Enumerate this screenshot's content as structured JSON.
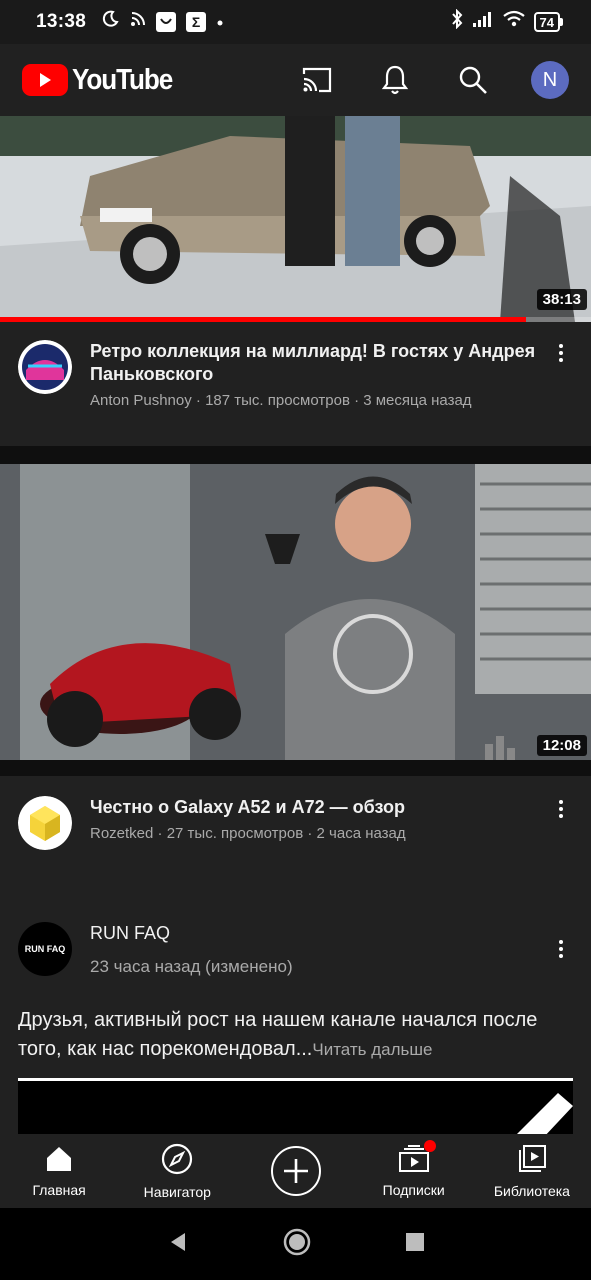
{
  "status_bar": {
    "time": "13:38",
    "battery": "74"
  },
  "app_bar": {
    "logo_text": "YouTube",
    "avatar_letter": "N"
  },
  "videos": [
    {
      "title": "Ретро коллекция на миллиард! В гостях у Андрея Паньковского",
      "subtitle": "Anton Pushnoy · 187 тыс. просмотров · 3 месяца назад",
      "duration": "38:13",
      "watched_fraction": 0.89
    },
    {
      "title": "Честно о Galaxy A52 и A72 — обзор",
      "subtitle": "Rozetked · 27 тыс. просмотров · 2 часа назад",
      "duration": "12:08"
    }
  ],
  "post": {
    "channel": "RUN FAQ",
    "avatar_text": "RUN FAQ",
    "time": "23 часа назад (изменено)",
    "text": "Друзья, активный рост на нашем канале начался после того, как нас порекомендовал...",
    "read_more": "Читать дальше"
  },
  "bottom_nav": {
    "home": "Главная",
    "explore": "Навигатор",
    "subscriptions": "Подписки",
    "library": "Библиотека"
  },
  "colors": {
    "brand_red": "#ff0000",
    "background": "#212121",
    "avatar_blue": "#5c6bc0"
  }
}
